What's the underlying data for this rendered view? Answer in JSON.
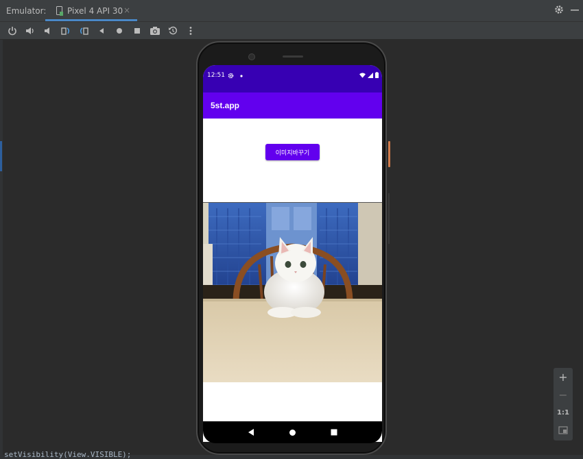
{
  "header": {
    "label": "Emulator:",
    "tab_title": "Pixel 4 API 30",
    "tab_close": "×"
  },
  "phone": {
    "status": {
      "time": "12:51"
    },
    "app_title": "5st.app",
    "button_label": "이미지바꾸기",
    "colors": {
      "status_bar": "#3700b3",
      "app_bar": "#6200ee",
      "button": "#6200ee"
    }
  },
  "zoom": {
    "plus": "+",
    "minus": "−",
    "one_to_one": "1:1"
  },
  "editor": {
    "bottom_text": "setVisibility(View.VISIBLE);"
  },
  "icons": {
    "toolbar": [
      "power-icon",
      "volume-up-icon",
      "volume-down-icon",
      "rotate-left-icon",
      "rotate-right-icon",
      "back-icon",
      "home-icon",
      "overview-icon",
      "screenshot-icon",
      "snapshot-icon",
      "more-icon"
    ],
    "top_right": [
      "gear-icon",
      "minimize-icon"
    ]
  }
}
